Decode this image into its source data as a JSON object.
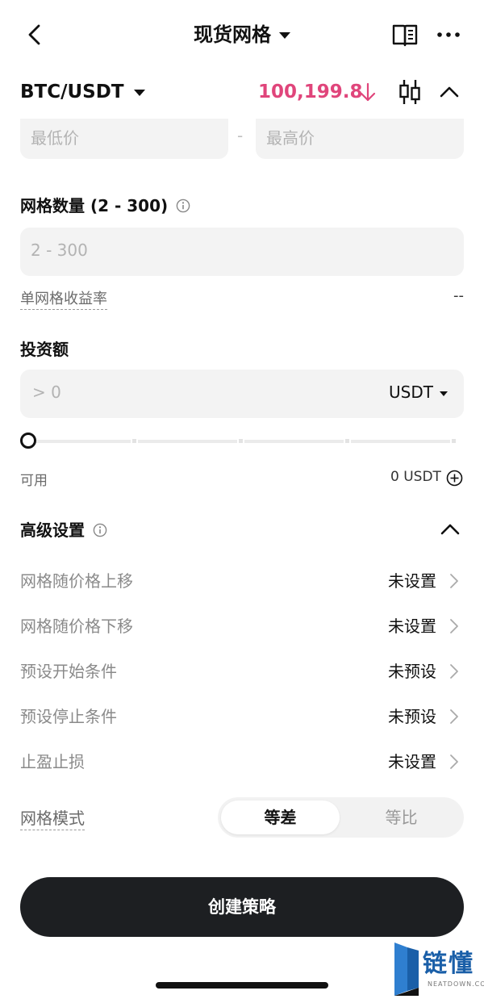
{
  "header": {
    "title": "现货网格",
    "icons": [
      "back-icon",
      "book-icon",
      "more-icon",
      "chevron-down-icon"
    ]
  },
  "pair": {
    "symbol": "BTC/USDT",
    "price": "100,199.8",
    "price_color": "#e0457b",
    "icons": [
      "down-arrow-icon",
      "candlestick-icon",
      "chevron-up-icon"
    ]
  },
  "price_range": {
    "min_placeholder": "最低价",
    "separator": "-",
    "max_placeholder": "最高价"
  },
  "grid_count": {
    "label": "网格数量 (2 - 300)",
    "placeholder": "2 - 300",
    "per_grid_label": "单网格收益率",
    "per_grid_value": "--"
  },
  "investment": {
    "label": "投资额",
    "placeholder": "> 0",
    "unit": "USDT",
    "slider_value": 0,
    "available_label": "可用",
    "available_value": "0 USDT"
  },
  "advanced": {
    "label": "高级设置",
    "rows": [
      {
        "name": "网格随价格上移",
        "value": "未设置"
      },
      {
        "name": "网格随价格下移",
        "value": "未设置"
      },
      {
        "name": "预设开始条件",
        "value": "未预设"
      },
      {
        "name": "预设停止条件",
        "value": "未预设"
      },
      {
        "name": "止盈止损",
        "value": "未设置"
      }
    ]
  },
  "grid_mode": {
    "label": "网格模式",
    "options": [
      "等差",
      "等比"
    ],
    "selected": "等差"
  },
  "actions": {
    "create_label": "创建策略"
  },
  "watermark": {
    "text": "链懂",
    "sub": "NEATDOWN.COM"
  },
  "colors": {
    "accent_dark": "#1d1f22",
    "price_down": "#e0457b",
    "input_bg": "#f3f3f3"
  }
}
